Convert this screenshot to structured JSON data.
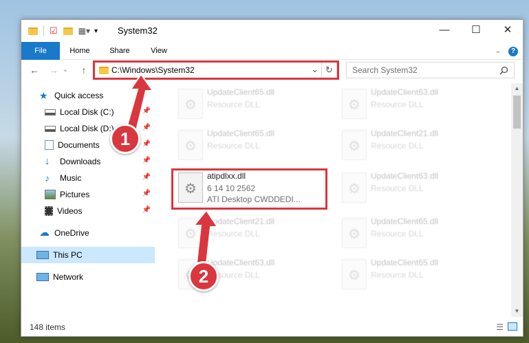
{
  "window": {
    "title": "System32",
    "minimize": "—",
    "maximize": "☐",
    "close": "✕"
  },
  "ribbon": {
    "tabs": [
      "File",
      "Home",
      "Share",
      "View"
    ],
    "expand": "⌄",
    "help": "?"
  },
  "address": {
    "back": "←",
    "forward": "→",
    "recent": "⌄",
    "up": "↑",
    "path": "C:\\Windows\\System32",
    "dropdown": "⌄",
    "refresh": "↻"
  },
  "search": {
    "placeholder": "Search System32",
    "icon": "search-icon"
  },
  "nav": {
    "items": [
      {
        "label": "Quick access",
        "icon": "star-icon",
        "pinned": false
      },
      {
        "label": "Local Disk (C:)",
        "icon": "drive-icon",
        "pinned": true
      },
      {
        "label": "Local Disk (D:)",
        "icon": "drive-icon",
        "pinned": true
      },
      {
        "label": "Documents",
        "icon": "documents-icon",
        "pinned": true
      },
      {
        "label": "Downloads",
        "icon": "download-icon",
        "pinned": true
      },
      {
        "label": "Music",
        "icon": "music-icon",
        "pinned": true
      },
      {
        "label": "Pictures",
        "icon": "pictures-icon",
        "pinned": true
      },
      {
        "label": "Videos",
        "icon": "videos-icon",
        "pinned": true
      },
      {
        "label": "OneDrive",
        "icon": "cloud-icon",
        "pinned": false
      },
      {
        "label": "This PC",
        "icon": "computer-icon",
        "pinned": false,
        "selected": true
      },
      {
        "label": "Network",
        "icon": "network-icon",
        "pinned": false
      }
    ]
  },
  "files": [
    {
      "name": "UpdateClient65.dll",
      "type": "Resource DLL"
    },
    {
      "name": "UpdateClient63.dll",
      "type": "Resource DLL"
    },
    {
      "name": "UpdateClient65.dll",
      "type": "Resource DLL"
    },
    {
      "name": "UpdateClient21.dll",
      "type": "Resource DLL"
    },
    {
      "name": "atipdlxx.dll",
      "version": "6 14 10 2562",
      "description": "ATI Desktop CWDDEDI..."
    },
    {
      "name": "UpdateClient63.dll",
      "type": "Resource DLL"
    },
    {
      "name": "UpdateClient21.dll",
      "type": "Resource DLL"
    },
    {
      "name": "UpdateClient65.dll",
      "type": "Resource DLL"
    },
    {
      "name": "UpdateClient63.dll",
      "type": "Resource DLL"
    },
    {
      "name": "UpdateClient65.dll",
      "type": "Resource DLL"
    }
  ],
  "status": {
    "count": "148 items"
  },
  "callouts": [
    "1",
    "2"
  ],
  "colors": {
    "accent": "#1979ca",
    "highlight": "#d9363e",
    "selection": "#cce8ff"
  }
}
